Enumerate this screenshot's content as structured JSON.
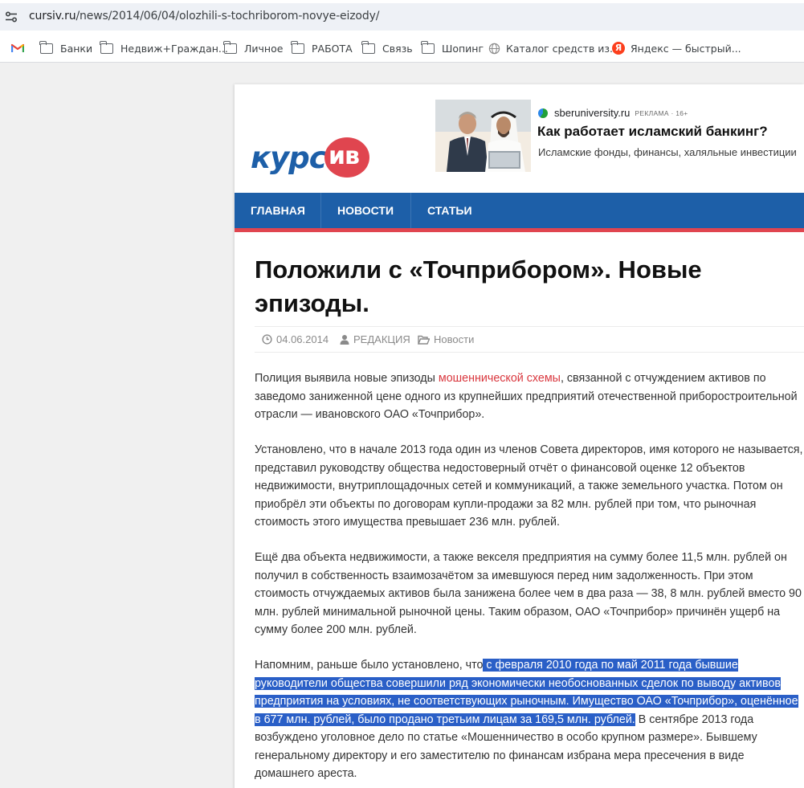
{
  "browser": {
    "url_host": "cursiv.ru",
    "url_path": "/news/2014/06/04/olozhili-s-tochriborom-novye-eizody/",
    "bookmarks": [
      {
        "label": "",
        "icon": "gmail-icon"
      },
      {
        "label": "Банки",
        "icon": "folder-icon"
      },
      {
        "label": "Недвиж+Граждан...",
        "icon": "folder-icon"
      },
      {
        "label": "Личное",
        "icon": "folder-icon"
      },
      {
        "label": "РАБОТА",
        "icon": "folder-icon"
      },
      {
        "label": "Связь",
        "icon": "folder-icon"
      },
      {
        "label": "Шопинг",
        "icon": "folder-icon"
      },
      {
        "label": "Каталог средств из...",
        "icon": "globe-icon"
      },
      {
        "label": "Яндекс — быстрый...",
        "icon": "yandex-icon"
      }
    ]
  },
  "site": {
    "logo_left": "курс",
    "logo_right": "ив",
    "brand_blue": "#1d5fa8",
    "brand_red": "#e0454f",
    "nav": [
      "ГЛАВНАЯ",
      "НОВОСТИ",
      "СТАТЬИ"
    ]
  },
  "ad": {
    "domain": "sberuniversity.ru",
    "tag": "РЕКЛАМА · 16+",
    "title": "Как работает исламский банкинг?",
    "desc": "Исламские фонды, финансы, халяльные инвестиции"
  },
  "article": {
    "title": "Положили с «Точприбором». Новые эпизоды.",
    "date": "04.06.2014",
    "author": "РЕДАКЦИЯ",
    "category": "Новости",
    "p1_a": "Полиция выявила новые эпизоды ",
    "p1_link": "мошеннической схемы",
    "p1_b": ", связанной с отчуждением активов по заведомо заниженной цене одного из крупнейших предприятий отечественной приборостроительной отрасли — ивановского ОАО «Точприбор».",
    "p2": "Установлено, что в начале 2013 года один из членов Совета директоров, имя которого не называется, представил руководству общества недостоверный отчёт о финансовой оценке 12 объектов недвижимости, внутриплощадочных сетей и коммуникаций, а также земельного участка. Потом он приобрёл эти объекты по договорам купли-продажи за 82 млн. рублей при том, что рыночная стоимость этого имущества превышает 236 млн. рублей.",
    "p3": "Ещё два объекта недвижимости, а также векселя предприятия на сумму более 11,5 млн. рублей он получил в собственность взаимозачётом за имевшуюся перед ним задолженность. При этом стоимость отчуждаемых активов была занижена более чем в два раза — 38, 8 млн. рублей вместо 90 млн. рублей минимальной рыночной цены. Таким образом, ОАО «Точприбор» причинён ущерб на сумму более 200 млн. рублей.",
    "p4_a": "Напомним, раньше было установлено, что",
    "p4_sel": " с февраля 2010 года по май 2011 года бывшие руководители общества совершили ряд экономически необоснованных сделок по выводу активов предприятия на условиях, не соответствующих рыночным. Имущество ОАО «Точприбор», оценённое в 677 млн. рублей, было продано третьим лицам за 169,5 млн. рублей.",
    "p4_b": " В сентябре 2013 года возбуждено уголовное дело по статье «Мошенничество в особо крупном размере». Бывшему генеральному директору и его заместителю по финансам избрана мера пресечения в виде домашнего ареста."
  }
}
